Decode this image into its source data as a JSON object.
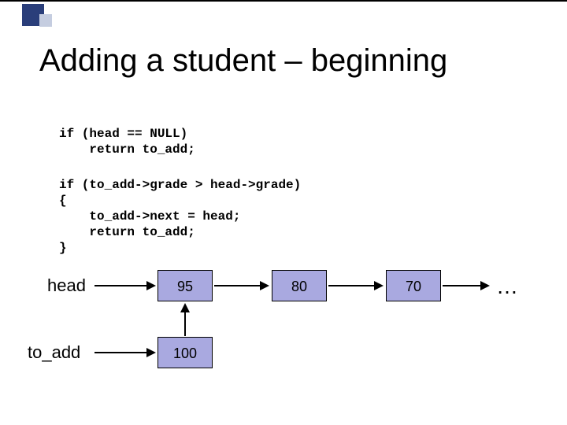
{
  "title": "Adding a student – beginning",
  "code": {
    "block1": "if (head == NULL)\n    return to_add;",
    "block2": "if (to_add->grade > head->grade)\n{\n    to_add->next = head;\n    return to_add;\n}"
  },
  "diagram": {
    "head_label": "head",
    "toadd_label": "to_add",
    "nodes": {
      "n95": "95",
      "n80": "80",
      "n70": "70",
      "n100": "100"
    },
    "ellipsis": "…"
  }
}
